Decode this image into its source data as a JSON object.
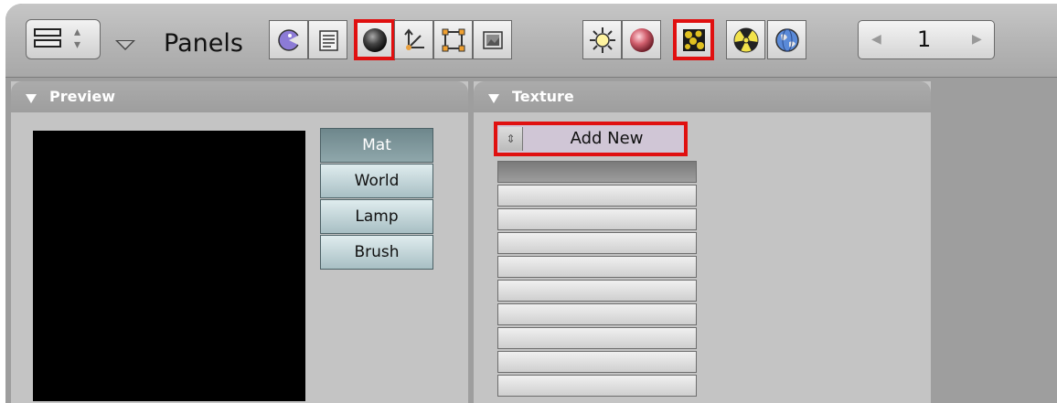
{
  "header": {
    "window_type_icon": "buttons-window-icon",
    "menu_toggle_icon": "triangle-down-icon",
    "panels_label": "Panels",
    "context_buttons": [
      {
        "name": "logic-button",
        "icon": "pacman-icon",
        "selected": false
      },
      {
        "name": "script-button",
        "icon": "script-icon",
        "selected": false
      },
      {
        "name": "shading-button",
        "icon": "shading-sphere-icon",
        "selected": true
      },
      {
        "name": "object-button",
        "icon": "object-axes-icon",
        "selected": false
      },
      {
        "name": "editing-button",
        "icon": "editing-square-icon",
        "selected": false
      },
      {
        "name": "scene-button",
        "icon": "scene-image-icon",
        "selected": false
      }
    ],
    "shading_sub_buttons": [
      {
        "name": "lamp-button",
        "icon": "lamp-sun-icon",
        "selected": false
      },
      {
        "name": "material-button",
        "icon": "material-sphere-icon",
        "selected": false
      },
      {
        "name": "texture-button",
        "icon": "texture-icon",
        "selected": true
      },
      {
        "name": "radiosity-button",
        "icon": "radiosity-icon",
        "selected": false
      },
      {
        "name": "world-button",
        "icon": "world-globe-icon",
        "selected": false
      }
    ],
    "frame_number": "1"
  },
  "preview_panel": {
    "title": "Preview",
    "buttons": [
      {
        "label": "Mat",
        "active": true
      },
      {
        "label": "World",
        "active": false
      },
      {
        "label": "Lamp",
        "active": false
      },
      {
        "label": "Brush",
        "active": false
      }
    ]
  },
  "texture_panel": {
    "title": "Texture",
    "add_new_label": "Add New",
    "slot_count": 10,
    "active_slot": 0
  },
  "colors": {
    "highlight": "#e01010",
    "active_tab": "#6e878c"
  }
}
